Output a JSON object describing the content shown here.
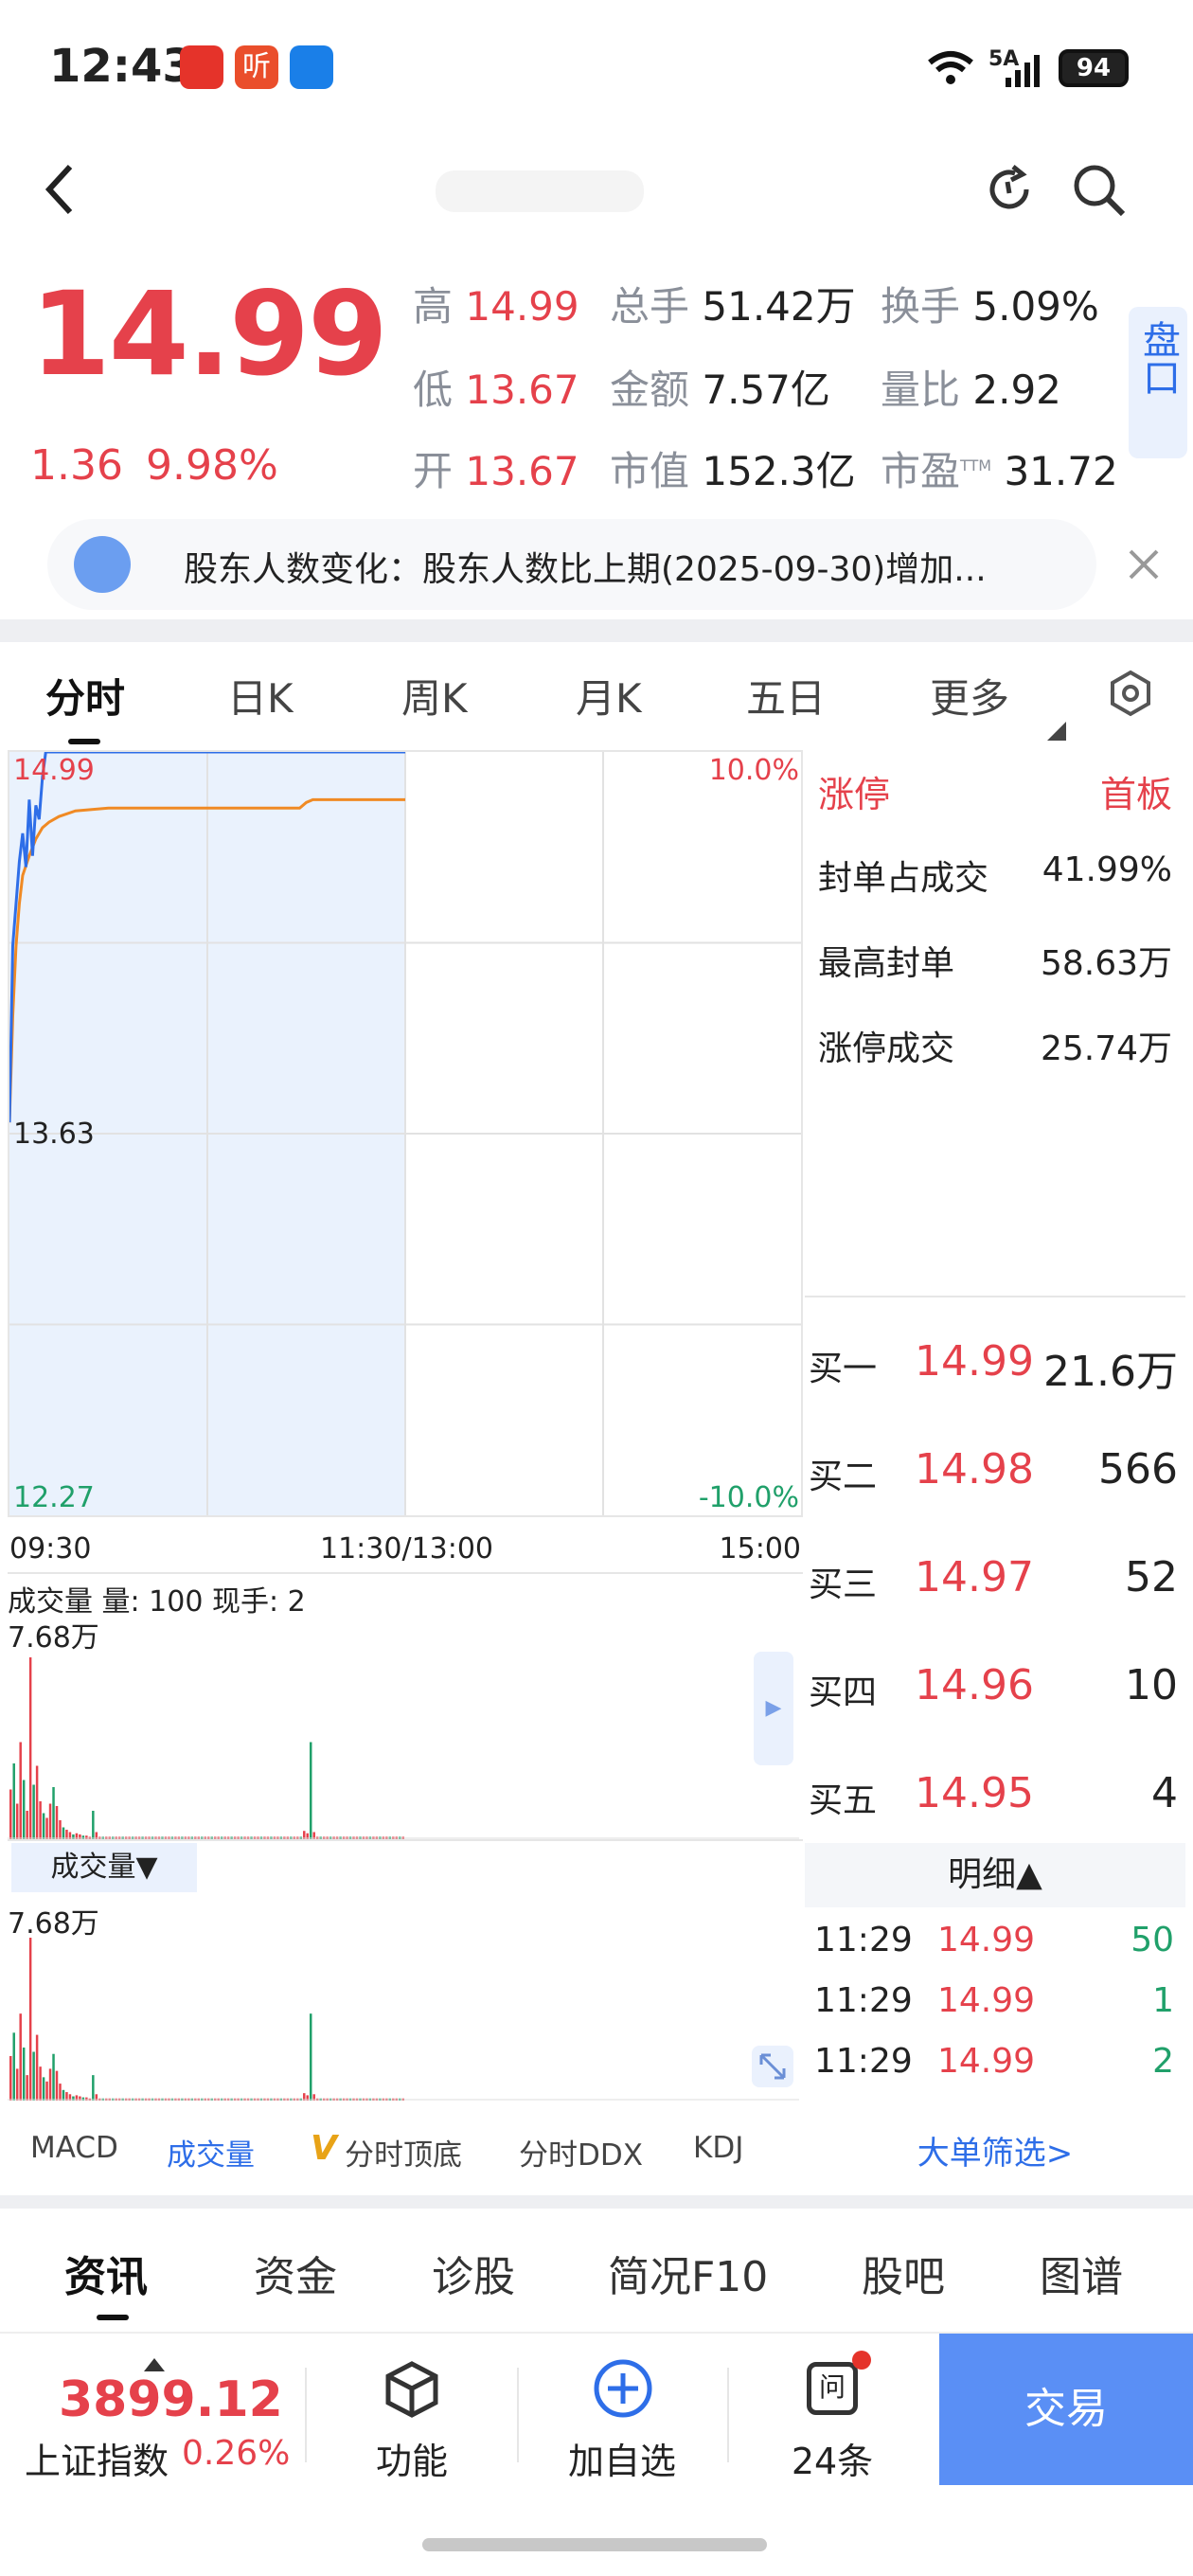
{
  "status_bar": {
    "time": "12:43",
    "signal": "5A",
    "battery": "94"
  },
  "header": {
    "refresh_icon": "refresh-icon",
    "search_icon": "search-icon"
  },
  "quote": {
    "price": "14.99",
    "change": "1.36",
    "change_pct": "9.98%",
    "high_label": "高",
    "high": "14.99",
    "low_label": "低",
    "low": "13.67",
    "open_label": "开",
    "open": "13.67",
    "vol_label": "总手",
    "vol": "51.42万",
    "amount_label": "金额",
    "amount": "7.57亿",
    "mcap_label": "市值",
    "mcap": "152.3亿",
    "turnover_label": "换手",
    "turnover": "5.09%",
    "ratio_label": "量比",
    "ratio": "2.92",
    "pe_label": "市盈",
    "pe_sup": "TTM",
    "pe": "31.72",
    "side_button": "盘口"
  },
  "notice": {
    "text": "股东人数变化：股东人数比上期(2025-09-30)增加..."
  },
  "chart_tabs": [
    "分时",
    "日K",
    "周K",
    "月K",
    "五日",
    "更多"
  ],
  "chart_data": {
    "type": "line",
    "price_axis": {
      "top": "14.99",
      "mid": "13.63",
      "bottom": "12.27",
      "top_pct": "10.0%",
      "bottom_pct": "-10.0%",
      "ylim": [
        12.27,
        14.99
      ]
    },
    "time_labels": [
      "09:30",
      "11:30/13:00",
      "15:00"
    ],
    "price_series": {
      "name": "price",
      "color": "#2e6ee8",
      "x": [
        0,
        1,
        2,
        3,
        4,
        5,
        6,
        7,
        8,
        9,
        10,
        11,
        12,
        15,
        20,
        40,
        120
      ],
      "y": [
        13.67,
        14.3,
        14.45,
        14.6,
        14.7,
        14.58,
        14.82,
        14.62,
        14.8,
        14.75,
        14.9,
        14.99,
        14.99,
        14.99,
        14.99,
        14.99,
        14.99
      ]
    },
    "avg_series": {
      "name": "avg",
      "color": "#f08a24",
      "x": [
        0,
        1,
        2,
        3,
        4,
        6,
        8,
        10,
        12,
        15,
        20,
        30,
        50,
        70,
        88,
        90,
        92,
        120
      ],
      "y": [
        13.67,
        14.05,
        14.3,
        14.45,
        14.55,
        14.62,
        14.68,
        14.72,
        14.74,
        14.76,
        14.78,
        14.79,
        14.79,
        14.79,
        14.79,
        14.81,
        14.82,
        14.82
      ]
    },
    "volume_panel": {
      "title": "成交量 量: 100 现手: 2",
      "max": "7.68万",
      "values": [
        2.1,
        3.2,
        1.5,
        4.1,
        2.5,
        1.2,
        7.68,
        2.3,
        3.1,
        1.6,
        1.1,
        0.9,
        1.5,
        2.2,
        1.4,
        0.8,
        0.5,
        0.4,
        0.3,
        0.2,
        0.25,
        0.2,
        0.15,
        0.15,
        0.1,
        1.2,
        0.3,
        0.1,
        0.1,
        0.1,
        0.1,
        0.1,
        0.1,
        0.1,
        0.1,
        0.1,
        0.1,
        0.1,
        0.1,
        0.1,
        0.1,
        0.1,
        0.1,
        0.1,
        0.1,
        0.1,
        0.1,
        0.1,
        0.1,
        0.1,
        0.1,
        0.1,
        0.1,
        0.1,
        0.1,
        0.1,
        0.1,
        0.1,
        0.1,
        0.1,
        0.1,
        0.1,
        0.1,
        0.1,
        0.1,
        0.1,
        0.1,
        0.1,
        0.1,
        0.1,
        0.1,
        0.1,
        0.1,
        0.1,
        0.1,
        0.1,
        0.1,
        0.1,
        0.1,
        0.1,
        0.1,
        0.1,
        0.1,
        0.1,
        0.1,
        0.1,
        0.1,
        0.1,
        0.1,
        0.35,
        0.25,
        4.1,
        0.3,
        0.1,
        0.1,
        0.1,
        0.1,
        0.1,
        0.1,
        0.1,
        0.1,
        0.1,
        0.1,
        0.1,
        0.1,
        0.1,
        0.1,
        0.1,
        0.1,
        0.1,
        0.1,
        0.1,
        0.1,
        0.1,
        0.1,
        0.1,
        0.1,
        0.1,
        0.1,
        0.1
      ]
    },
    "volume_panel2": {
      "selector": "成交量▼",
      "max": "7.68万"
    }
  },
  "limit_panel": {
    "title": "涨停",
    "badge": "首板",
    "rows": [
      {
        "label": "封单占成交",
        "value": "41.99%"
      },
      {
        "label": "最高封单",
        "value": "58.63万"
      },
      {
        "label": "涨停成交",
        "value": "25.74万"
      }
    ]
  },
  "order_book": [
    {
      "label": "买一",
      "price": "14.99",
      "qty": "21.6万"
    },
    {
      "label": "买二",
      "price": "14.98",
      "qty": "566"
    },
    {
      "label": "买三",
      "price": "14.97",
      "qty": "52"
    },
    {
      "label": "买四",
      "price": "14.96",
      "qty": "10"
    },
    {
      "label": "买五",
      "price": "14.95",
      "qty": "4"
    }
  ],
  "detail": {
    "title": "明细▲",
    "rows": [
      {
        "time": "11:29",
        "price": "14.99",
        "qty": "50"
      },
      {
        "time": "11:29",
        "price": "14.99",
        "qty": "1"
      },
      {
        "time": "11:29",
        "price": "14.99",
        "qty": "2"
      }
    ],
    "link": "大单筛选>"
  },
  "indicator_tabs": [
    "MACD",
    "成交量",
    "分时顶底",
    "分时DDX",
    "KDJ"
  ],
  "indicator_v": "V",
  "bottom_tabs": [
    "资讯",
    "资金",
    "诊股",
    "简况F10",
    "股吧",
    "图谱"
  ],
  "footer": {
    "index_value": "3899.12",
    "index_name": "上证指数",
    "index_pct": "0.26%",
    "func_label": "功能",
    "add_label": "加自选",
    "msg_label": "24条",
    "trade_label": "交易"
  }
}
